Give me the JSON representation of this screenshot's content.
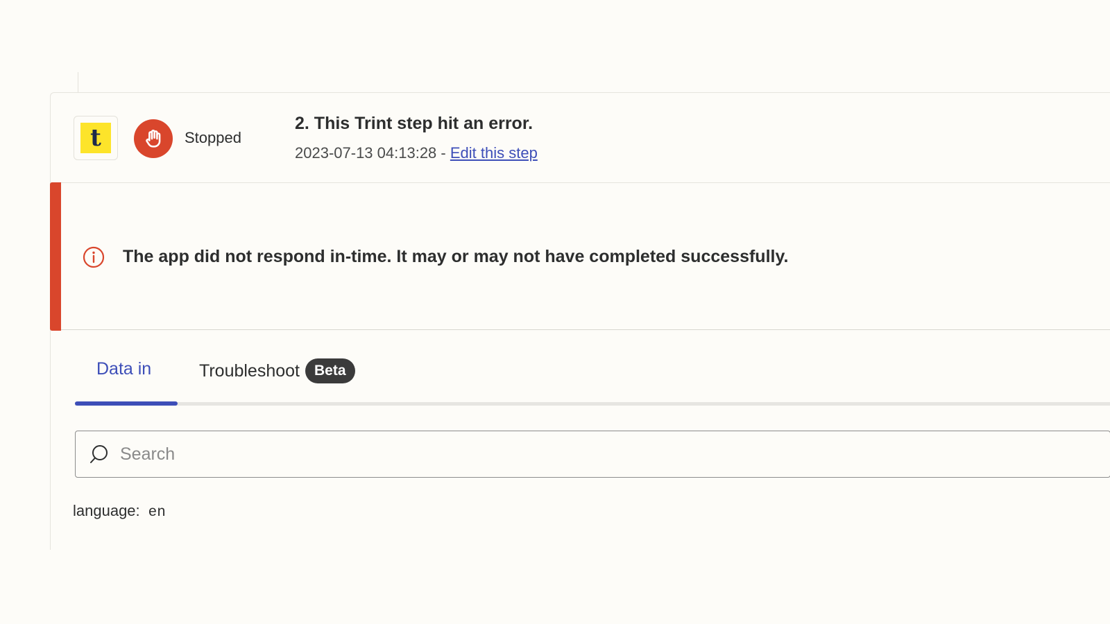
{
  "step": {
    "app_logo_letter": "t",
    "status_label": "Stopped",
    "title": "2. This Trint step hit an error.",
    "timestamp": "2023-07-13 04:13:28",
    "separator": " - ",
    "edit_link_label": "Edit this step"
  },
  "error": {
    "message": "The app did not respond in-time. It may or may not have completed successfully."
  },
  "tabs": [
    {
      "label": "Data in",
      "active": true
    },
    {
      "label": "Troubleshoot",
      "badge": "Beta",
      "active": false
    }
  ],
  "search": {
    "placeholder": "Search",
    "value": ""
  },
  "data_fields": [
    {
      "key": "language:",
      "value": "en"
    }
  ],
  "colors": {
    "accent": "#3d4eb8",
    "error": "#d9462c",
    "logo_bg": "#fde42a",
    "background": "#fdfcf8"
  },
  "icons": {
    "status": "hand-stop-icon",
    "error": "info-circle-icon",
    "search": "search-icon"
  }
}
